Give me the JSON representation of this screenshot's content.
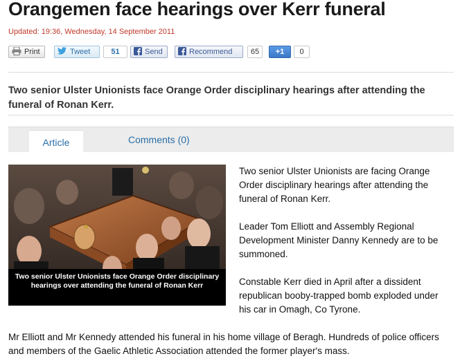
{
  "article": {
    "title": "Orangemen face hearings over Kerr funeral",
    "updated": "Updated: 19:36, Wednesday, 14 September 2011",
    "standfirst": "Two senior Ulster Unionists face Orange Order disciplinary hearings after attending the funeral of Ronan Kerr.",
    "paragraphs": [
      "Two senior Ulster Unionists are facing Orange Order disciplinary hearings after attending the funeral of Ronan Kerr.",
      "Leader Tom Elliott and Assembly Regional Development Minister Danny Kennedy are to be summoned.",
      "Constable Kerr died in April after a dissident republican booby-trapped bomb exploded under his car in Omagh, Co Tyrone.",
      "Mr Elliott and Mr Kennedy attended his funeral in his home village of Beragh. Hundreds of police officers and members of the Gaelic Athletic Association attended the former player's mass."
    ],
    "image_caption": "Two senior Ulster Unionists face Orange Order disciplinary hearings over attending the funeral of Ronan Kerr"
  },
  "share": {
    "print": "Print",
    "tweet": "Tweet",
    "tweet_count": "51",
    "send": "Send",
    "recommend": "Recommend",
    "recommend_count": "65",
    "plusone": "+1",
    "plusone_count": "0"
  },
  "tabs": [
    {
      "label": "Article",
      "active": true
    },
    {
      "label": "Comments (0)",
      "active": false
    }
  ],
  "colors": {
    "link": "#2a6ea7",
    "updated": "#c0392b",
    "facebook": "#3b5998"
  }
}
